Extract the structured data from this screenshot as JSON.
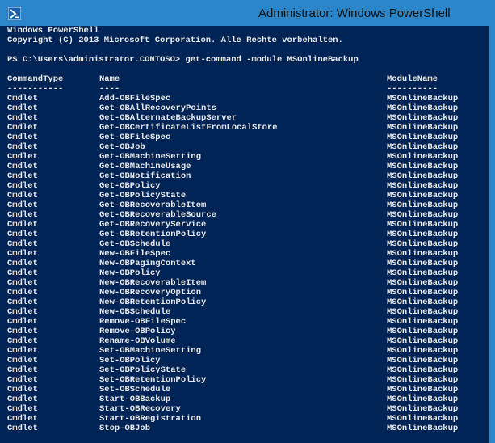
{
  "window": {
    "title": "Administrator: Windows PowerShell",
    "icon": "powershell-icon"
  },
  "console": {
    "banner_line1": "Windows PowerShell",
    "banner_line2": "Copyright (C) 2013 Microsoft Corporation. Alle Rechte vorbehalten.",
    "prompt": "PS C:\\Users\\administrator.CONTOSO> get-command -module MSOnlineBackup",
    "headers": [
      "CommandType",
      "Name",
      "ModuleName"
    ],
    "separators": [
      "-----------",
      "----",
      "----------"
    ],
    "rows": [
      [
        "Cmdlet",
        "Add-OBFileSpec",
        "MSOnlineBackup"
      ],
      [
        "Cmdlet",
        "Get-OBAllRecoveryPoints",
        "MSOnlineBackup"
      ],
      [
        "Cmdlet",
        "Get-OBAlternateBackupServer",
        "MSOnlineBackup"
      ],
      [
        "Cmdlet",
        "Get-OBCertificateListFromLocalStore",
        "MSOnlineBackup"
      ],
      [
        "Cmdlet",
        "Get-OBFileSpec",
        "MSOnlineBackup"
      ],
      [
        "Cmdlet",
        "Get-OBJob",
        "MSOnlineBackup"
      ],
      [
        "Cmdlet",
        "Get-OBMachineSetting",
        "MSOnlineBackup"
      ],
      [
        "Cmdlet",
        "Get-OBMachineUsage",
        "MSOnlineBackup"
      ],
      [
        "Cmdlet",
        "Get-OBNotification",
        "MSOnlineBackup"
      ],
      [
        "Cmdlet",
        "Get-OBPolicy",
        "MSOnlineBackup"
      ],
      [
        "Cmdlet",
        "Get-OBPolicyState",
        "MSOnlineBackup"
      ],
      [
        "Cmdlet",
        "Get-OBRecoverableItem",
        "MSOnlineBackup"
      ],
      [
        "Cmdlet",
        "Get-OBRecoverableSource",
        "MSOnlineBackup"
      ],
      [
        "Cmdlet",
        "Get-OBRecoveryService",
        "MSOnlineBackup"
      ],
      [
        "Cmdlet",
        "Get-OBRetentionPolicy",
        "MSOnlineBackup"
      ],
      [
        "Cmdlet",
        "Get-OBSchedule",
        "MSOnlineBackup"
      ],
      [
        "Cmdlet",
        "New-OBFileSpec",
        "MSOnlineBackup"
      ],
      [
        "Cmdlet",
        "New-OBPagingContext",
        "MSOnlineBackup"
      ],
      [
        "Cmdlet",
        "New-OBPolicy",
        "MSOnlineBackup"
      ],
      [
        "Cmdlet",
        "New-OBRecoverableItem",
        "MSOnlineBackup"
      ],
      [
        "Cmdlet",
        "New-OBRecoveryOption",
        "MSOnlineBackup"
      ],
      [
        "Cmdlet",
        "New-OBRetentionPolicy",
        "MSOnlineBackup"
      ],
      [
        "Cmdlet",
        "New-OBSchedule",
        "MSOnlineBackup"
      ],
      [
        "Cmdlet",
        "Remove-OBFileSpec",
        "MSOnlineBackup"
      ],
      [
        "Cmdlet",
        "Remove-OBPolicy",
        "MSOnlineBackup"
      ],
      [
        "Cmdlet",
        "Rename-OBVolume",
        "MSOnlineBackup"
      ],
      [
        "Cmdlet",
        "Set-OBMachineSetting",
        "MSOnlineBackup"
      ],
      [
        "Cmdlet",
        "Set-OBPolicy",
        "MSOnlineBackup"
      ],
      [
        "Cmdlet",
        "Set-OBPolicyState",
        "MSOnlineBackup"
      ],
      [
        "Cmdlet",
        "Set-OBRetentionPolicy",
        "MSOnlineBackup"
      ],
      [
        "Cmdlet",
        "Set-OBSchedule",
        "MSOnlineBackup"
      ],
      [
        "Cmdlet",
        "Start-OBBackup",
        "MSOnlineBackup"
      ],
      [
        "Cmdlet",
        "Start-OBRecovery",
        "MSOnlineBackup"
      ],
      [
        "Cmdlet",
        "Start-OBRegistration",
        "MSOnlineBackup"
      ],
      [
        "Cmdlet",
        "Stop-OBJob",
        "MSOnlineBackup"
      ]
    ]
  },
  "colors": {
    "console_background": "#012456",
    "console_text": "#e9e9e9",
    "titlebar": "#2a86c8"
  }
}
